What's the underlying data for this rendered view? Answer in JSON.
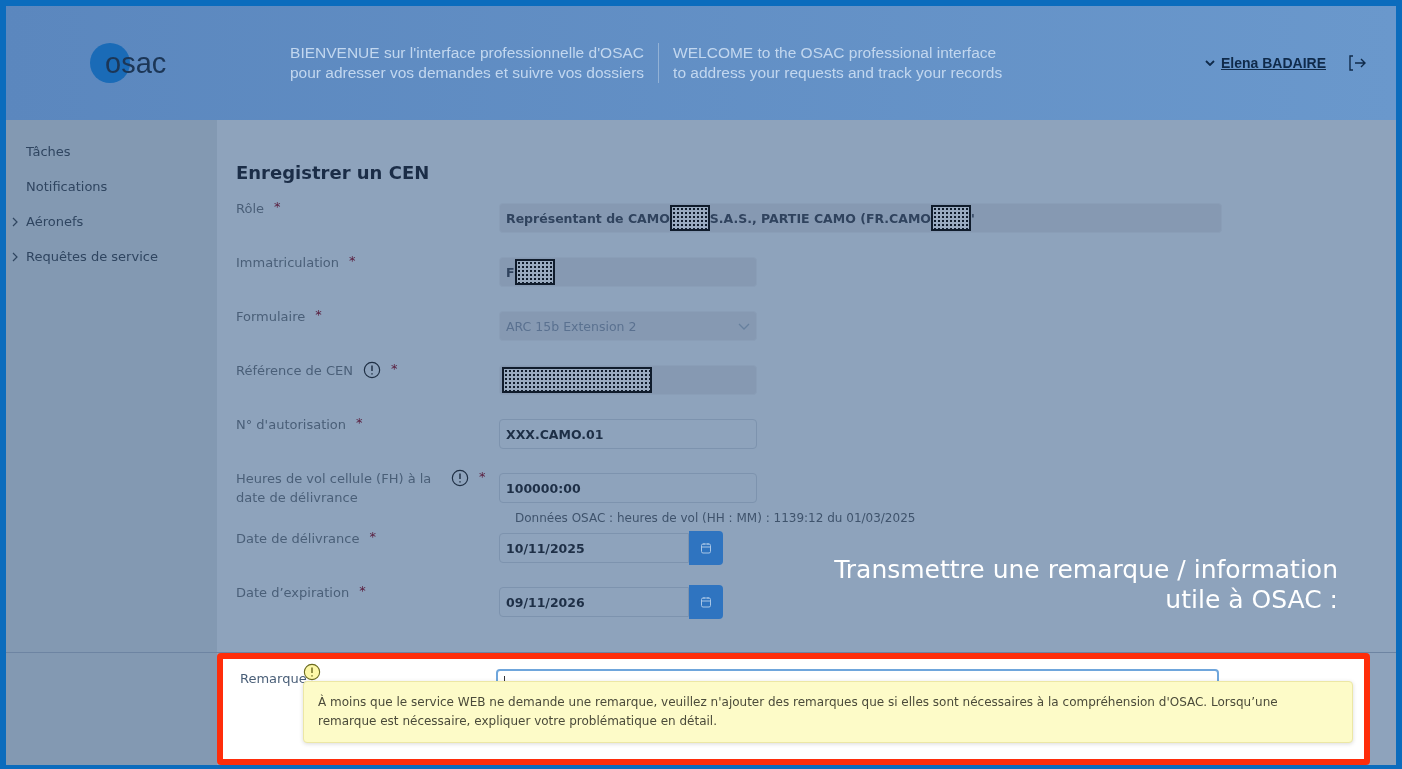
{
  "header": {
    "logo": "osac",
    "welcome_fr": [
      "BIENVENUE sur l'interface professionnelle d'OSAC",
      "pour adresser vos demandes et suivre vos dossiers"
    ],
    "welcome_en": [
      "WELCOME to the OSAC professional interface",
      "to address your requests and track your records"
    ],
    "user": "Elena BADAIRE"
  },
  "sidebar": {
    "items": [
      {
        "label": "Tâches",
        "expandable": false
      },
      {
        "label": "Notifications",
        "expandable": false
      },
      {
        "label": "Aéronefs",
        "expandable": true
      },
      {
        "label": "Requêtes de service",
        "expandable": true
      }
    ]
  },
  "form": {
    "title": "Enregistrer un CEN",
    "fields": [
      {
        "label": "Rôle",
        "required_mark": "*",
        "info": false,
        "kind": "text",
        "wide": true,
        "disabled": true,
        "segments": [
          {
            "kind": "text",
            "text": "Représentant de CAMO"
          },
          {
            "kind": "redaction"
          },
          {
            "kind": "text",
            "text": "S.A.S., PARTIE CAMO (FR.CAMO"
          },
          {
            "kind": "redaction"
          },
          {
            "kind": "text",
            "text": "'"
          }
        ]
      },
      {
        "label": "Immatriculation",
        "required_mark": "*",
        "info": false,
        "kind": "text",
        "wide": false,
        "disabled": true,
        "segments": [
          {
            "kind": "text",
            "text": "F"
          },
          {
            "kind": "redaction"
          }
        ]
      },
      {
        "label": "Formulaire",
        "required_mark": "*",
        "info": false,
        "kind": "select",
        "wide": false,
        "disabled": true,
        "segments": [
          {
            "kind": "text",
            "text": "ARC 15b Extension 2"
          }
        ]
      },
      {
        "label": "Référence de CEN",
        "required_mark": "*",
        "info": true,
        "kind": "text",
        "wide": false,
        "disabled": true,
        "segments": [
          {
            "kind": "redaction"
          }
        ]
      },
      {
        "label": "N° d'autorisation",
        "required_mark": "*",
        "info": false,
        "kind": "text",
        "wide": false,
        "disabled": false,
        "segments": [
          {
            "kind": "text",
            "text": "XXX.CAMO.01"
          }
        ]
      },
      {
        "label": "Heures de vol cellule (FH) à la date de délivrance",
        "required_mark": "*",
        "info": true,
        "kind": "text",
        "wide": false,
        "disabled": false,
        "segments": [
          {
            "kind": "text",
            "text": "100000:00"
          }
        ],
        "hint": "Données OSAC : heures de vol (HH : MM) : 1139:12 du 01/03/2025"
      },
      {
        "label": "Date de délivrance",
        "required_mark": "*",
        "info": false,
        "kind": "date",
        "wide": false,
        "disabled": false,
        "segments": [
          {
            "kind": "text",
            "text": "10/11/2025"
          }
        ]
      },
      {
        "label": "Date d’expiration",
        "required_mark": "*",
        "info": false,
        "kind": "date",
        "wide": false,
        "disabled": false,
        "segments": [
          {
            "kind": "text",
            "text": "09/11/2026"
          }
        ]
      }
    ]
  },
  "annotation": "Transmettre une remarque / information utile à OSAC :",
  "remark": {
    "label": "Remarque",
    "tooltip": "À moins que le service WEB ne demande une remarque, veuillez n'ajouter des remarques que si elles sont nécessaires à la compréhension d'OSAC. Lorsqu’une remarque est nécessaire, expliquer votre problématique en détail."
  }
}
